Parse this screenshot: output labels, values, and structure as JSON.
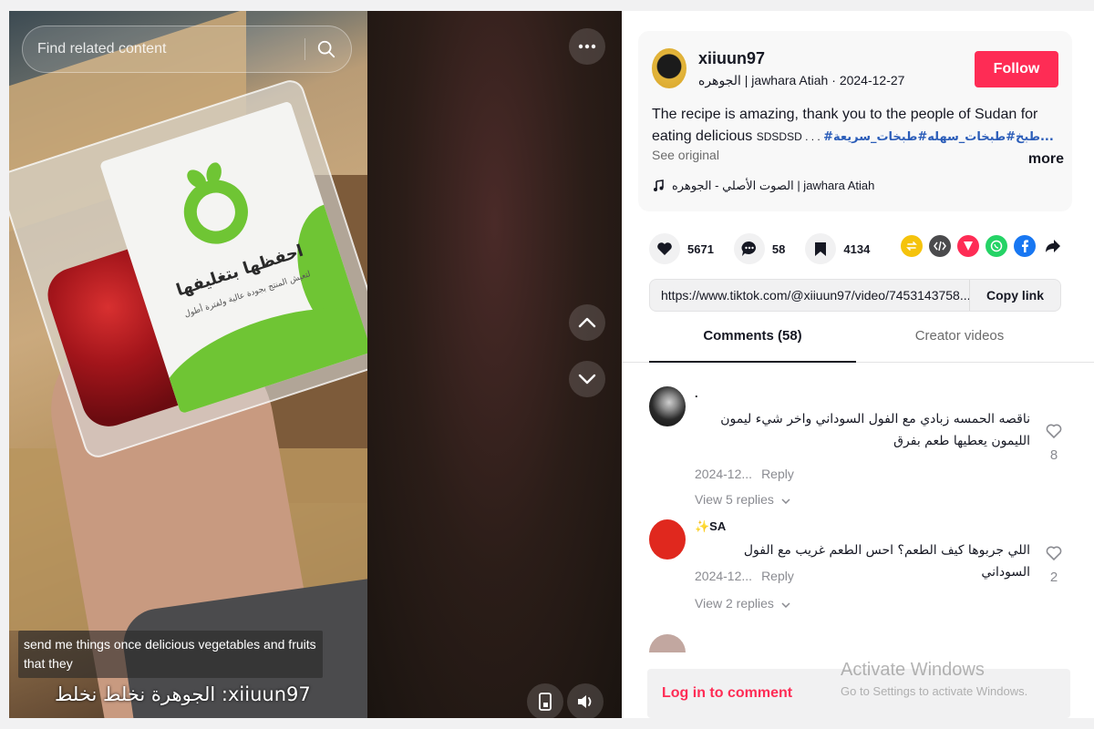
{
  "video": {
    "search_placeholder": "Find related content",
    "package_label_title": "احفظها بتغليفها",
    "package_label_sub": "لتعيش المنتج بجودة عالية ولفترة أطول",
    "caption_english": "send me things once delicious vegetables and fruits that they",
    "caption_arabic": "الجوهرة نخلط نخلط :xiiuun97"
  },
  "post": {
    "username": "xiiuun97",
    "display_name": "الجوهره | jawhara Atiah",
    "date": "2024-12-27",
    "follow_label": "Follow",
    "description_text": "The recipe is amazing, thank you to the people of Sudan for eating delicious ",
    "description_sd": "SDSDSD . . . ",
    "hashtags": "#طبخ#طبخات_سهله#طبخات_سريعة...",
    "more_label": "more",
    "see_original": "See original",
    "music": "الصوت الأصلي - الجوهره | jawhara Atiah",
    "likes": "5671",
    "comments_count": "58",
    "saves": "4134",
    "link_url": "https://www.tiktok.com/@xiiuun97/video/7453143758...",
    "copy_link_label": "Copy link"
  },
  "tabs": {
    "comments": "Comments (58)",
    "creator_videos": "Creator videos"
  },
  "comments": [
    {
      "name": ".",
      "text": "ناقصه الحمسه زبادي مع الفول السوداني واخر شيء ليمون الليمون يعطيها طعم بفرق",
      "date": "2024-12...",
      "reply_label": "Reply",
      "view_replies": "View 5 replies",
      "likes": "8"
    },
    {
      "name": "✨SA",
      "text": "اللي جربوها كيف الطعم؟ احس الطعم غريب مع الفول السوداني",
      "date": "2024-12...",
      "reply_label": "Reply",
      "view_replies": "View 2 replies",
      "likes": "2"
    }
  ],
  "login": {
    "label": "Log in to comment"
  },
  "watermark": {
    "title": "Activate Windows",
    "subtitle": "Go to Settings to activate Windows."
  },
  "icons": {
    "search": "search-icon",
    "more": "more-dots-icon",
    "up": "chevron-up-icon",
    "down": "chevron-down-icon",
    "flip": "phone-flip-icon",
    "volume": "volume-icon",
    "heart": "heart-icon",
    "comment": "comment-icon",
    "bookmark": "bookmark-icon",
    "music": "music-note-icon",
    "repost": "repost-icon",
    "embed": "embed-icon",
    "send": "send-icon",
    "whatsapp": "whatsapp-icon",
    "facebook": "facebook-icon",
    "share": "share-arrow-icon"
  },
  "colors": {
    "accent": "#fe2c55",
    "hashtag": "#2b5db9",
    "brand_green": "#6fc534"
  }
}
